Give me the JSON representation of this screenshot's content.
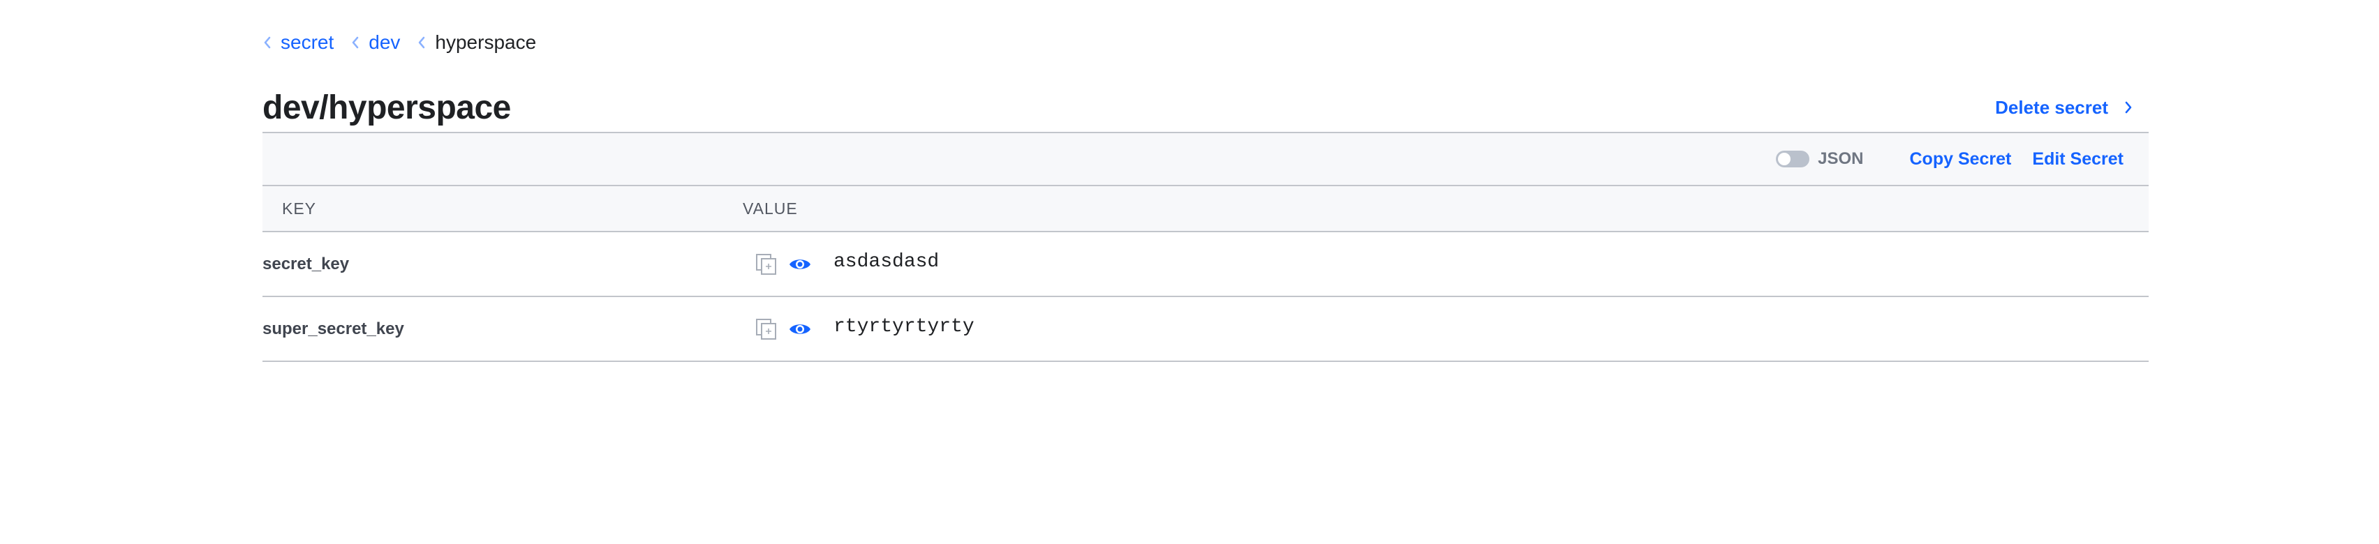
{
  "breadcrumb": {
    "items": [
      {
        "label": "secret"
      },
      {
        "label": "dev"
      }
    ],
    "current": "hyperspace"
  },
  "page": {
    "title": "dev/hyperspace",
    "delete_label": "Delete secret"
  },
  "toolbar": {
    "json_toggle_label": "JSON",
    "json_toggle_on": false,
    "copy_label": "Copy Secret",
    "edit_label": "Edit Secret"
  },
  "table": {
    "headers": {
      "key": "KEY",
      "value": "VALUE"
    },
    "rows": [
      {
        "key": "secret_key",
        "value": "asdasdasd"
      },
      {
        "key": "super_secret_key",
        "value": "rtyrtyrtyrty"
      }
    ]
  },
  "icons": {
    "copy": "copy-icon",
    "reveal": "eye-icon",
    "breadcrumb_separator": "chevron-left-icon",
    "delete_chevron": "chevron-right-icon"
  },
  "colors": {
    "link": "#1563ff",
    "text": "#1f2124",
    "toolbar_bg": "#f7f8fa",
    "border": "#c2c5cb",
    "toggle_off": "#bac1cc"
  }
}
